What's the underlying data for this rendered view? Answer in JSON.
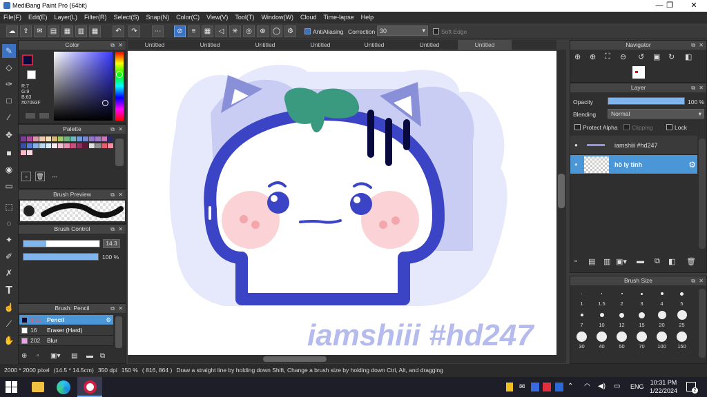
{
  "app": {
    "title": "MediBang Paint Pro (64bit)"
  },
  "window_buttons": {
    "minimize": "—",
    "maximize": "❐",
    "close": "✕"
  },
  "menu": [
    "File(F)",
    "Edit(E)",
    "Layer(L)",
    "Filter(R)",
    "Select(S)",
    "Snap(N)",
    "Color(C)",
    "View(V)",
    "Tool(T)",
    "Window(W)",
    "Cloud",
    "Time-lapse",
    "Help"
  ],
  "toolbar": {
    "antialiasing_label": "AntiAliasing",
    "correction_label": "Correction",
    "correction_value": "30",
    "soft_edge_label": "Soft Edge"
  },
  "color_panel": {
    "title": "Color",
    "r": "R:7",
    "g": "G:9",
    "b": "B:63",
    "hex": "#07093F",
    "fg": "#07093f",
    "bg": "#ffffff"
  },
  "palette_panel": {
    "title": "Palette",
    "footer_text": "---",
    "colors": [
      "#7a3e9a",
      "#b04aa0",
      "#d89aa8",
      "#f1c9b0",
      "#f5e0b8",
      "#d9b779",
      "#a0c76c",
      "#6fb67e",
      "#70b8c0",
      "#6f9bd6",
      "#7a86d0",
      "#8e78c8",
      "#a07bc8",
      "#c87ab8",
      "#2a2a6a",
      "#3a4fa0",
      "#5a7ad0",
      "#8ab0e8",
      "#b8d8f0",
      "#d8ecf8",
      "#f8e8f0",
      "#f0c0d0",
      "#e890b0",
      "#c85080",
      "#903060",
      "#601838",
      "#e0e0e0",
      "#909090",
      "#e06070",
      "#f090a0",
      "#f8b8c8",
      "#fcd8e0"
    ]
  },
  "brush_preview": {
    "title": "Brush Preview"
  },
  "brush_control": {
    "title": "Brush Control",
    "size": "14.3",
    "opacity": "100 %",
    "size_fraction": 0.3,
    "opacity_fraction": 1.0
  },
  "brush_list": {
    "title": "Brush: Pencil",
    "items": [
      {
        "size": "14.3",
        "name": "Pencil",
        "active": true,
        "color": "#07093f"
      },
      {
        "size": "16",
        "name": "Eraser (Hard)",
        "active": false,
        "color": "#ffffff"
      },
      {
        "size": "202",
        "name": "Blur",
        "active": false,
        "color": "#f0a0e8"
      }
    ]
  },
  "tabs": [
    "Untitled",
    "Untitled",
    "Untitled",
    "Untitled",
    "Untitled",
    "Untitled",
    "Untitled"
  ],
  "canvas": {
    "watermark": "iamshiii #hd247"
  },
  "navigator": {
    "title": "Navigator"
  },
  "layer_panel": {
    "title": "Layer",
    "opacity_label": "Opacity",
    "opacity_value": "100 %",
    "opacity_fraction": 1.0,
    "blending_label": "Blending",
    "blending_value": "Normal",
    "protect_alpha": "Protect Alpha",
    "clipping": "Clipping",
    "lock": "Lock",
    "layers": [
      {
        "name": "iamshiii #hd247",
        "selected": false
      },
      {
        "name": "hö ly tinh",
        "selected": true
      }
    ]
  },
  "brush_size_panel": {
    "title": "Brush Size",
    "sizes": [
      "1",
      "1.5",
      "2",
      "3",
      "4",
      "5",
      "7",
      "10",
      "12",
      "15",
      "20",
      "25",
      "30",
      "40",
      "50",
      "70",
      "100",
      "150"
    ]
  },
  "status": {
    "dims": "2000 * 2000 pixel",
    "cm": "(14.5 * 14.5cm)",
    "dpi": "350 dpi",
    "zoom": "150 %",
    "coords": "( 816, 864 )",
    "hint": "Draw a straight line by holding down Shift, Change a brush size by holding down Ctrl, Alt, and dragging"
  },
  "taskbar": {
    "lang": "ENG",
    "time": "10:31 PM",
    "date": "1/22/2024",
    "notif_count": "2"
  },
  "colors": {
    "accent": "#3b73c2",
    "mascot_outline": "#3a44c4",
    "leaf": "#3a9a80"
  }
}
